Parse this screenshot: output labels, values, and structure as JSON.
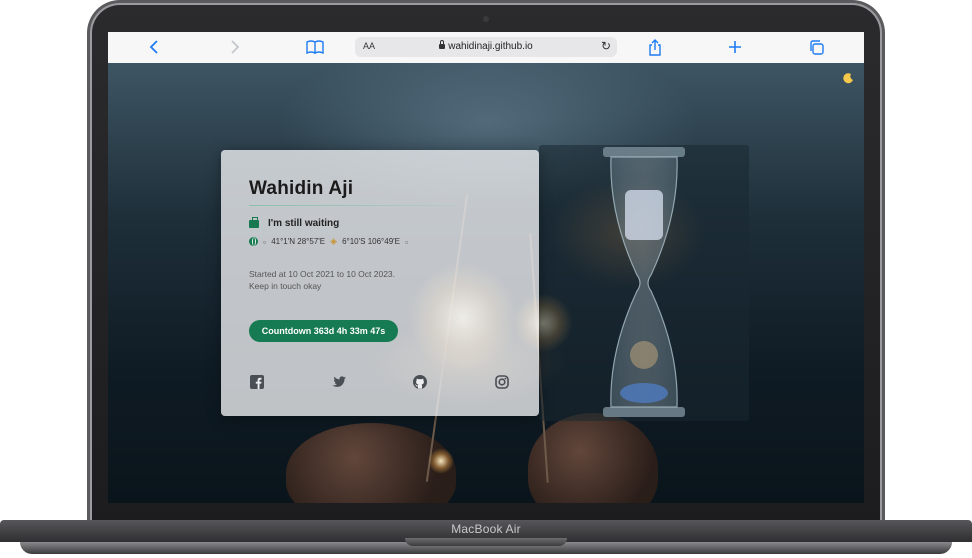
{
  "device": {
    "label": "MacBook Air"
  },
  "browser": {
    "text_size_label": "AA",
    "url": "wahidinaji.github.io"
  },
  "card": {
    "name": "Wahidin Aji",
    "status": "I'm still waiting",
    "location": {
      "from": "41°1'N 28°57'E",
      "to": "6°10'S 106°49'E"
    },
    "started_line": "Started at 10 Oct 2021 to 10 Oct 2023.",
    "keep_line": "Keep in touch okay",
    "countdown_button": "Countdown 363d 4h 33m 47s",
    "social": [
      "facebook-icon",
      "twitter-icon",
      "github-icon",
      "instagram-icon"
    ]
  },
  "theme": {
    "accent": "#167a52",
    "link_blue": "#1f7cf3",
    "moon": "#f6c94a"
  }
}
